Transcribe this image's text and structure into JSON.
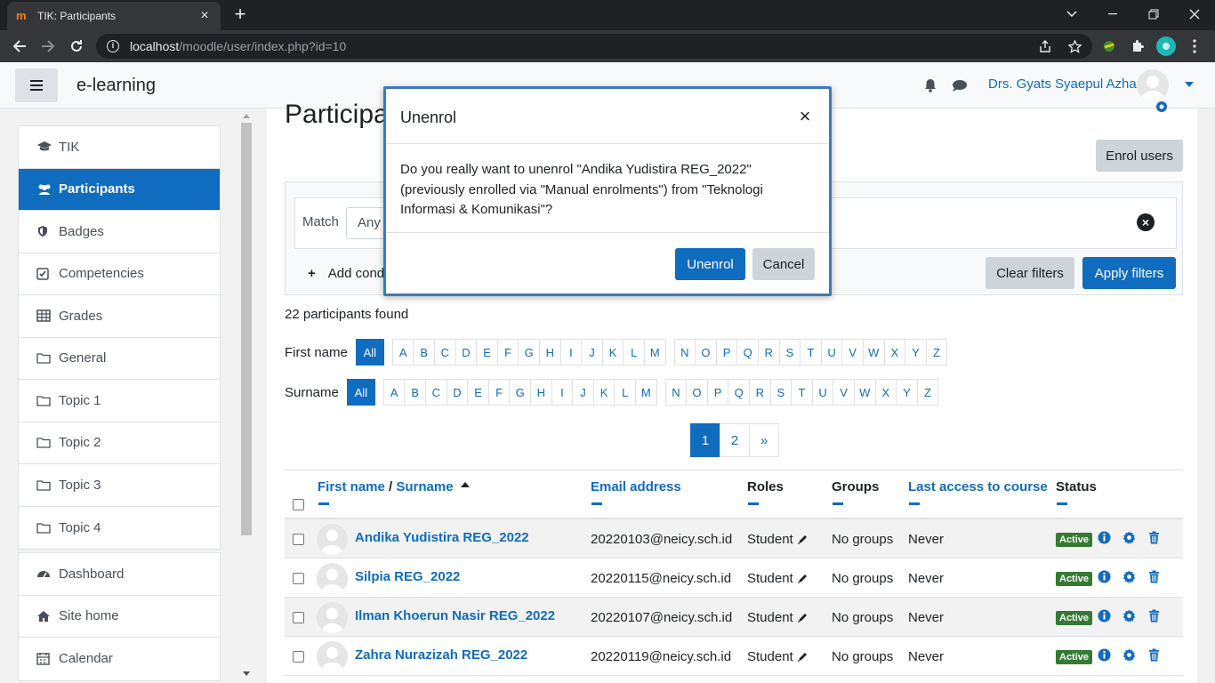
{
  "browser": {
    "tab_title": "TIK: Participants",
    "url_host": "localhost",
    "url_path": "/moodle/user/index.php?id=10"
  },
  "navbar": {
    "brand": "e-learning",
    "user_name": "Drs. Gyats Syaepul Azhar"
  },
  "drawer": {
    "course_items": [
      {
        "label": "TIK",
        "icon": "graduation-cap-icon"
      },
      {
        "label": "Participants",
        "icon": "users-icon",
        "active": true
      },
      {
        "label": "Badges",
        "icon": "shield-icon"
      },
      {
        "label": "Competencies",
        "icon": "check-square-icon"
      },
      {
        "label": "Grades",
        "icon": "table-icon"
      },
      {
        "label": "General",
        "icon": "folder-icon"
      },
      {
        "label": "Topic 1",
        "icon": "folder-icon"
      },
      {
        "label": "Topic 2",
        "icon": "folder-icon"
      },
      {
        "label": "Topic 3",
        "icon": "folder-icon"
      },
      {
        "label": "Topic 4",
        "icon": "folder-icon"
      }
    ],
    "site_items": [
      {
        "label": "Dashboard",
        "icon": "dashboard-icon"
      },
      {
        "label": "Site home",
        "icon": "home-icon"
      },
      {
        "label": "Calendar",
        "icon": "calendar-icon"
      }
    ]
  },
  "main": {
    "heading": "Participan",
    "enrol_button": "Enrol users",
    "filter": {
      "match_label": "Match",
      "match_value": "Any",
      "add_condition": "Add cond",
      "clear_filters": "Clear filters",
      "apply_filters": "Apply filters"
    },
    "found_text": "22 participants found",
    "firstname_label": "First name",
    "surname_label": "Surname",
    "all_label": "All",
    "letters": [
      "A",
      "B",
      "C",
      "D",
      "E",
      "F",
      "G",
      "H",
      "I",
      "J",
      "K",
      "L",
      "M",
      "N",
      "O",
      "P",
      "Q",
      "R",
      "S",
      "T",
      "U",
      "V",
      "W",
      "X",
      "Y",
      "Z"
    ],
    "pages": [
      "1",
      "2",
      "»"
    ],
    "columns": {
      "first_name": "First name",
      "separator": "/",
      "surname": "Surname",
      "email": "Email address",
      "roles": "Roles",
      "groups": "Groups",
      "last_access": "Last access to course",
      "status": "Status"
    },
    "rows": [
      {
        "name": "Andika Yudistira REG_2022",
        "email": "20220103@neicy.sch.id",
        "role": "Student",
        "groups": "No groups",
        "last_access": "Never",
        "status": "Active"
      },
      {
        "name": "Silpia REG_2022",
        "email": "20220115@neicy.sch.id",
        "role": "Student",
        "groups": "No groups",
        "last_access": "Never",
        "status": "Active"
      },
      {
        "name": "Ilman Khoerun Nasir REG_2022",
        "email": "20220107@neicy.sch.id",
        "role": "Student",
        "groups": "No groups",
        "last_access": "Never",
        "status": "Active"
      },
      {
        "name": "Zahra Nurazizah REG_2022",
        "email": "20220119@neicy.sch.id",
        "role": "Student",
        "groups": "No groups",
        "last_access": "Never",
        "status": "Active"
      }
    ]
  },
  "modal": {
    "title": "Unenrol",
    "body": "Do you really want to unenrol \"Andika Yudistira REG_2022\" (previously enrolled via \"Manual enrolments\") from \"Teknologi Informasi & Komunikasi\"?",
    "confirm": "Unenrol",
    "cancel": "Cancel"
  },
  "colors": {
    "primary": "#0f6cbf",
    "active_badge": "#357a32",
    "chrome_dark": "#202124"
  }
}
